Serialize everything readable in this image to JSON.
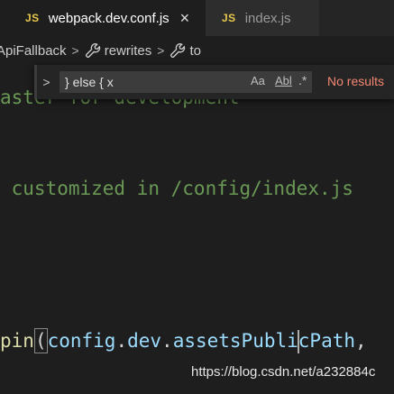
{
  "tabs": [
    {
      "badge": "JS",
      "label": "webpack.dev.conf.js",
      "close": "×",
      "active": true
    },
    {
      "badge": "JS",
      "label": "index.js",
      "active": false
    }
  ],
  "breadcrumb": {
    "items": [
      "ApiFallback",
      "rewrites",
      "to"
    ],
    "separator": ">"
  },
  "find": {
    "toggle_glyph": ">",
    "value": "} else { x",
    "match_case": "Aa",
    "whole_word": "Abl",
    "regex": ".*",
    "result": "No results"
  },
  "code": {
    "line1": "aster for development",
    "line2": " customized in /config/index.js",
    "line3": {
      "fn_tail": "pin",
      "open_paren": "(",
      "obj": "config",
      "dot1": ".",
      "prop1": "dev",
      "dot2": ".",
      "prop2_before_cursor": "assetsPubli",
      "prop2_after_cursor": "cPath",
      "comma": ","
    }
  },
  "watermark": "https://blog.csdn.net/a232884c",
  "colors": {
    "background": "#1e1e1e",
    "comment": "#6a9955",
    "identifier": "#9cdcfe",
    "function": "#dcdcaa",
    "js_badge": "#e8c84b",
    "no_results": "#f48771"
  }
}
